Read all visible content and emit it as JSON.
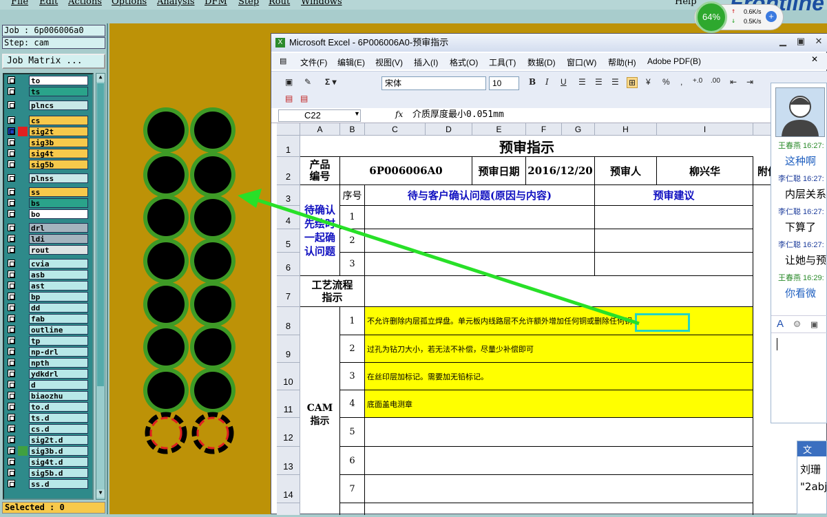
{
  "menu": [
    "File",
    "Edit",
    "Actions",
    "Options",
    "Analysis",
    "DFM",
    "Step",
    "Rout",
    "Windows"
  ],
  "help_label": "Help",
  "brand": "Frontline",
  "speed": {
    "percent": "64%",
    "up": "0.6K/s",
    "down": "0.5K/s",
    "plus": "+"
  },
  "job": {
    "job_label": "Job : 6p006006a0",
    "step_label": "Step: cam",
    "matrix_button": "Job Matrix ...",
    "selected": "Selected : 0"
  },
  "layers": [
    {
      "name": "to",
      "color": "#ffffff"
    },
    {
      "name": "ts",
      "color": "#2aa38a"
    },
    {
      "name": "plncs",
      "color": "#c8e8e8"
    },
    {
      "name": "cs",
      "color": "#f7c94b"
    },
    {
      "name": "sig2t",
      "color": "#f7c94b"
    },
    {
      "name": "sig3b",
      "color": "#f7c94b"
    },
    {
      "name": "sig4t",
      "color": "#f7c94b"
    },
    {
      "name": "sig5b",
      "color": "#f7c94b"
    },
    {
      "name": "plnss",
      "color": "#c8e8e8"
    },
    {
      "name": "ss",
      "color": "#f7c94b"
    },
    {
      "name": "bs",
      "color": "#2aa38a"
    },
    {
      "name": "bo",
      "color": "#ffffff"
    },
    {
      "name": "drl",
      "color": "#a4b4be"
    },
    {
      "name": "ldi",
      "color": "#a4b4be"
    },
    {
      "name": "rout",
      "color": "#dde4e4"
    },
    {
      "name": "cvia",
      "color": "#b8e8e8"
    },
    {
      "name": "asb",
      "color": "#b8e8e8"
    },
    {
      "name": "ast",
      "color": "#b8e8e8"
    },
    {
      "name": "bp",
      "color": "#b8e8e8"
    },
    {
      "name": "dd",
      "color": "#b8e8e8"
    },
    {
      "name": "fab",
      "color": "#b8e8e8"
    },
    {
      "name": "outline",
      "color": "#b8e8e8"
    },
    {
      "name": "tp",
      "color": "#b8e8e8"
    },
    {
      "name": "np-drl",
      "color": "#b8e8e8"
    },
    {
      "name": "npth",
      "color": "#b8e8e8"
    },
    {
      "name": "ydkdrl",
      "color": "#b8e8e8"
    },
    {
      "name": "d",
      "color": "#b8e8e8"
    },
    {
      "name": "biaozhu",
      "color": "#b8e8e8"
    },
    {
      "name": "to.d",
      "color": "#b8e8e8"
    },
    {
      "name": "ts.d",
      "color": "#b8e8e8"
    },
    {
      "name": "cs.d",
      "color": "#b8e8e8"
    },
    {
      "name": "sig2t.d",
      "color": "#b8e8e8"
    },
    {
      "name": "sig3b.d",
      "color": "#b8e8e8"
    },
    {
      "name": "sig4t.d",
      "color": "#b8e8e8"
    },
    {
      "name": "sig5b.d",
      "color": "#b8e8e8"
    },
    {
      "name": "ss.d",
      "color": "#b8e8e8"
    }
  ],
  "excel": {
    "title": "Microsoft Excel - 6P006006A0-预审指示",
    "menu": [
      "文件(F)",
      "编辑(E)",
      "视图(V)",
      "插入(I)",
      "格式(O)",
      "工具(T)",
      "数据(D)",
      "窗口(W)",
      "帮助(H)",
      "Adobe PDF(B)"
    ],
    "font": "宋体",
    "size": "10",
    "name_box": "C22",
    "fx": "fx",
    "formula": "介质厚度最小0.051mm",
    "columns": [
      "A",
      "B",
      "C",
      "D",
      "E",
      "F",
      "G",
      "H",
      "I"
    ],
    "rows": [
      "1",
      "2",
      "3",
      "4",
      "5",
      "6",
      "7",
      "8",
      "9",
      "10",
      "11",
      "12",
      "13",
      "14"
    ],
    "sheet_title": "预审指示",
    "product_label": "产品编号",
    "product_value": "6P006006A0",
    "date_label": "预审日期",
    "date_value": "2016/12/20",
    "reviewer_label": "预审人",
    "reviewer_value": "柳兴华",
    "attach_label": "附件",
    "seq_label": "序号",
    "question_label": "待与客户确认问题(原因与内容)",
    "suggest_label": "预审建议",
    "confirm_label": "待确认先绘时一起确认问题",
    "process_label": "工艺流程指示",
    "cam_label": "CAM指示",
    "nums": [
      "1",
      "2",
      "3",
      "1",
      "2",
      "3",
      "4",
      "5",
      "6",
      "7"
    ],
    "items": [
      "不允许删除内层孤立焊盘。单元板内线路层不允许额外增加任何铜或删除任何铜",
      "过孔为钻刀大小，若无法不补偿，尽量少补偿即可",
      "在丝印层加标记。需要加无铅标记。",
      "底面盖电测章"
    ]
  },
  "chat": {
    "messages": [
      {
        "name": "王春燕 16:27:",
        "text": "这种啊",
        "color": "#2a8a2a",
        "tcolor": "#2060c0"
      },
      {
        "name": "李仁聪 16:27:",
        "text": "内层关系",
        "color": "#1a3a9a",
        "tcolor": "#000000"
      },
      {
        "name": "李仁聪 16:27:",
        "text": "下算了",
        "color": "#1a3a9a",
        "tcolor": "#000000"
      },
      {
        "name": "李仁聪 16:27:",
        "text": "让她与预",
        "color": "#1a3a9a",
        "tcolor": "#000000"
      },
      {
        "name": "王春燕 16:29:",
        "text": "你看微",
        "color": "#2a8a2a",
        "tcolor": "#2060c0"
      }
    ],
    "toolbar": [
      "A",
      "☺",
      "▣"
    ],
    "second_title": "文",
    "second_lines": [
      "刘珊 ",
      "\"2abj"
    ]
  }
}
